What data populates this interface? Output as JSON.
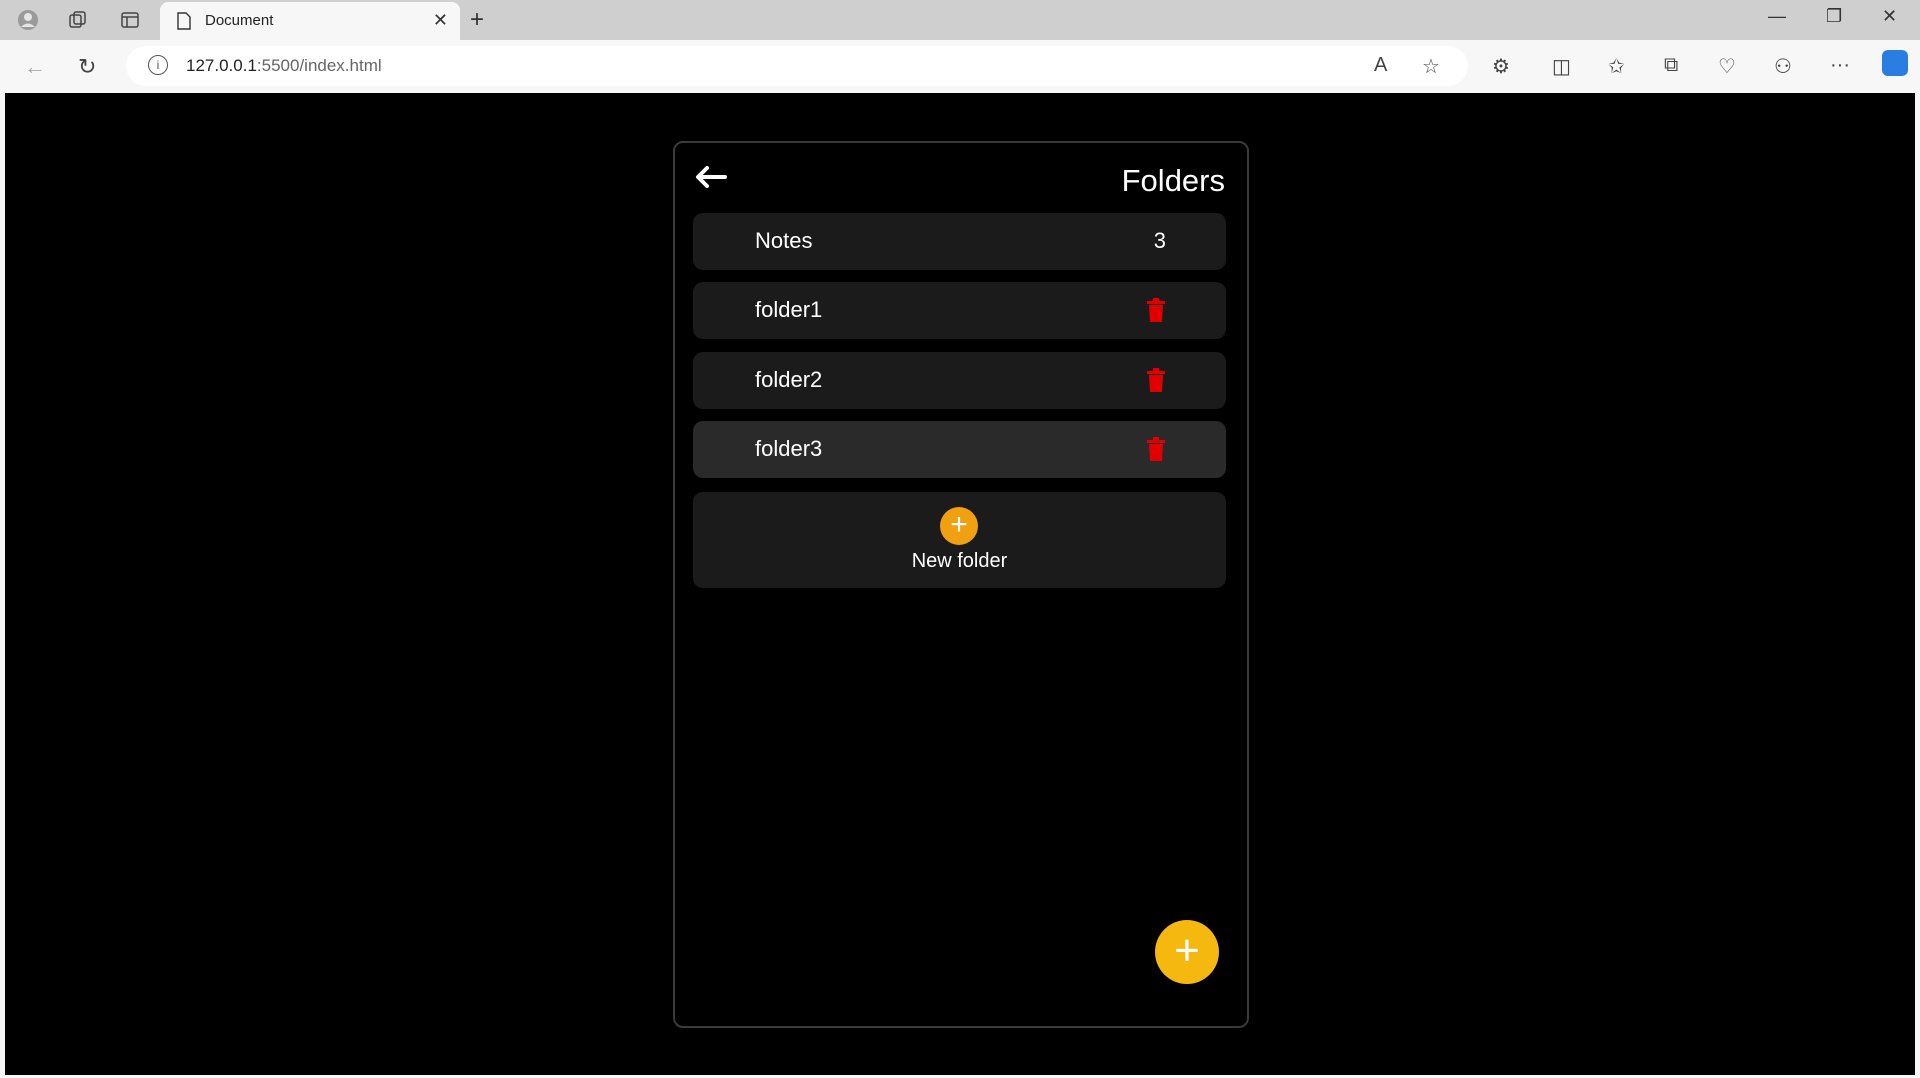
{
  "browser": {
    "tab_title": "Document",
    "url_host": "127.0.0.1",
    "url_rest": ":5500/index.html"
  },
  "app": {
    "title": "Folders",
    "notes_row": {
      "label": "Notes",
      "count": "3"
    },
    "folders": [
      {
        "label": "folder1"
      },
      {
        "label": "folder2"
      },
      {
        "label": "folder3"
      }
    ],
    "new_folder_label": "New folder",
    "new_folder_plus": "+",
    "fab_plus": "+"
  },
  "colors": {
    "accent_orange": "#f0a010",
    "fab_yellow": "#f4b80f",
    "trash_red": "#e00000",
    "row_bg": "#1b1b1b"
  }
}
